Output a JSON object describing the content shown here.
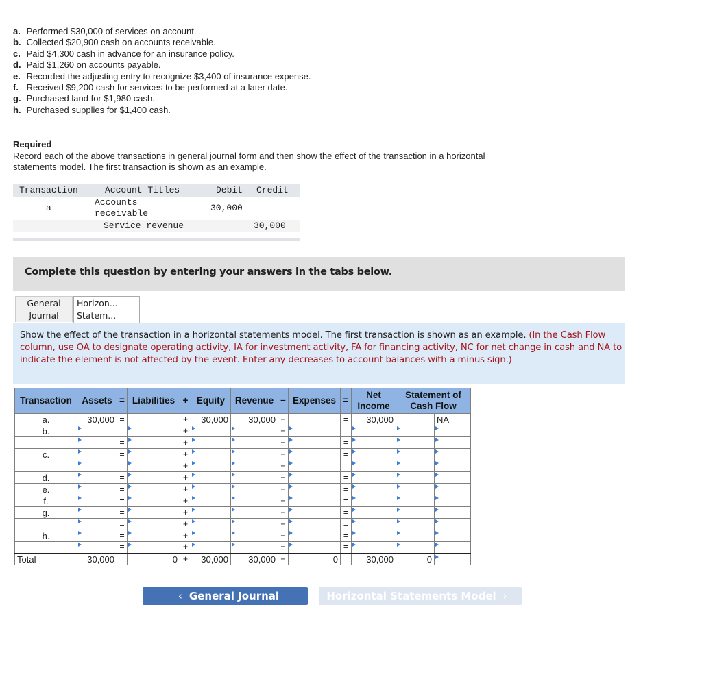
{
  "transactions": [
    {
      "letter": "a.",
      "text": "Performed $30,000 of services on account."
    },
    {
      "letter": "b.",
      "text": "Collected $20,900 cash on accounts receivable."
    },
    {
      "letter": "c.",
      "text": "Paid $4,300 cash in advance for an insurance policy."
    },
    {
      "letter": "d.",
      "text": "Paid $1,260 on accounts payable."
    },
    {
      "letter": "e.",
      "text": "Recorded the adjusting entry to recognize $3,400 of insurance expense."
    },
    {
      "letter": "f.",
      "text": "Received $9,200 cash for services to be performed at a later date."
    },
    {
      "letter": "g.",
      "text": "Purchased land for $1,980 cash."
    },
    {
      "letter": "h.",
      "text": "Purchased supplies for $1,400 cash."
    }
  ],
  "required": {
    "title": "Required",
    "text": "Record each of the above transactions in general journal form and then show the effect of the transaction in a horizontal statements model. The first transaction is shown as an example."
  },
  "example_journal": {
    "headers": {
      "transaction": "Transaction",
      "account_titles": "Account Titles",
      "debit": "Debit",
      "credit": "Credit"
    },
    "rows": [
      {
        "transaction": "a",
        "account_line1": "Accounts",
        "account_line2": "receivable",
        "debit": "30,000",
        "credit": ""
      },
      {
        "transaction": "",
        "account_line1": "Service revenue",
        "account_line2": "",
        "debit": "",
        "credit": "30,000"
      }
    ]
  },
  "banner": {
    "text": "Complete this question by entering your answers in the tabs below."
  },
  "tabs": [
    {
      "line1": "General",
      "line2": "Journal",
      "active": false
    },
    {
      "line1": "Horizon...",
      "line2": "Statem...",
      "active": true
    }
  ],
  "instructions": {
    "main": "Show the effect of the transaction in a horizontal statements model. The first transaction is shown as an example.",
    "note": "(In the Cash Flow column, use OA to designate operating activity, IA for investment activity, FA for financing activity, NC for net change in cash and NA to indicate the element is not affected by the event. Enter any decreases to account balances with a minus sign.)"
  },
  "hsm": {
    "headers": {
      "transaction": "Transaction",
      "assets": "Assets",
      "eq1": "=",
      "liabilities": "Liabilities",
      "plus": "+",
      "equity": "Equity",
      "revenue": "Revenue",
      "minus": "−",
      "expenses": "Expenses",
      "eq2": "=",
      "net_income_1": "Net",
      "net_income_2": "Income",
      "cash_flow_1": "Statement of",
      "cash_flow_2": "Cash Flow"
    },
    "ops": {
      "eq": "=",
      "plus": "+",
      "minus": "−"
    },
    "rows": [
      {
        "label": "a.",
        "assets": "30,000",
        "liabilities": "",
        "equity": "30,000",
        "revenue": "30,000",
        "expenses": "",
        "net_income": "30,000",
        "cf_amount": "",
        "cf_activity": "NA",
        "example": true
      },
      {
        "label": "b.",
        "assets": "",
        "liabilities": "",
        "equity": "",
        "revenue": "",
        "expenses": "",
        "net_income": "",
        "cf_amount": "",
        "cf_activity": ""
      },
      {
        "label": "",
        "assets": "",
        "liabilities": "",
        "equity": "",
        "revenue": "",
        "expenses": "",
        "net_income": "",
        "cf_amount": "",
        "cf_activity": ""
      },
      {
        "label": "c.",
        "assets": "",
        "liabilities": "",
        "equity": "",
        "revenue": "",
        "expenses": "",
        "net_income": "",
        "cf_amount": "",
        "cf_activity": ""
      },
      {
        "label": "",
        "assets": "",
        "liabilities": "",
        "equity": "",
        "revenue": "",
        "expenses": "",
        "net_income": "",
        "cf_amount": "",
        "cf_activity": ""
      },
      {
        "label": "d.",
        "assets": "",
        "liabilities": "",
        "equity": "",
        "revenue": "",
        "expenses": "",
        "net_income": "",
        "cf_amount": "",
        "cf_activity": ""
      },
      {
        "label": "e.",
        "assets": "",
        "liabilities": "",
        "equity": "",
        "revenue": "",
        "expenses": "",
        "net_income": "",
        "cf_amount": "",
        "cf_activity": ""
      },
      {
        "label": "f.",
        "assets": "",
        "liabilities": "",
        "equity": "",
        "revenue": "",
        "expenses": "",
        "net_income": "",
        "cf_amount": "",
        "cf_activity": ""
      },
      {
        "label": "g.",
        "assets": "",
        "liabilities": "",
        "equity": "",
        "revenue": "",
        "expenses": "",
        "net_income": "",
        "cf_amount": "",
        "cf_activity": ""
      },
      {
        "label": "",
        "assets": "",
        "liabilities": "",
        "equity": "",
        "revenue": "",
        "expenses": "",
        "net_income": "",
        "cf_amount": "",
        "cf_activity": ""
      },
      {
        "label": "h.",
        "assets": "",
        "liabilities": "",
        "equity": "",
        "revenue": "",
        "expenses": "",
        "net_income": "",
        "cf_amount": "",
        "cf_activity": ""
      },
      {
        "label": "",
        "assets": "",
        "liabilities": "",
        "equity": "",
        "revenue": "",
        "expenses": "",
        "net_income": "",
        "cf_amount": "",
        "cf_activity": ""
      }
    ],
    "total": {
      "label": "Total",
      "assets": "30,000",
      "liabilities": "0",
      "equity": "30,000",
      "revenue": "30,000",
      "expenses": "0",
      "net_income": "30,000",
      "cf_amount": "0",
      "cf_activity": ""
    }
  },
  "nav": {
    "prev_label": "General Journal",
    "next_label": "Horizontal Statements Model",
    "prev_icon": "‹",
    "next_icon": "›"
  }
}
